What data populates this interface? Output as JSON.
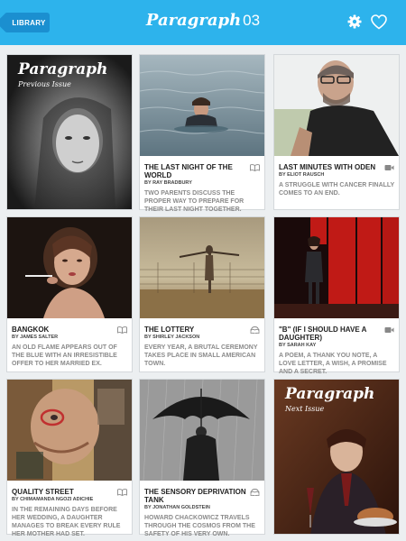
{
  "header": {
    "library_label": "LIBRARY",
    "brand": "Paragraph",
    "issue": "03"
  },
  "previous_cover": {
    "brand": "Paragraph",
    "label": "Previous Issue"
  },
  "next_cover": {
    "brand": "Paragraph",
    "label": "Next Issue"
  },
  "stories": [
    {
      "title": "THE LAST NIGHT OF THE WORLD",
      "author": "BY RAY BRADBURY",
      "description": "Two parents discuss the proper way to prepare for their last night together.",
      "type": "book-icon"
    },
    {
      "title": "LAST MINUTES WITH ODEN",
      "author": "BY ELIOT RAUSCH",
      "description": "A struggle with cancer finally comes to an end.",
      "type": "video-icon"
    },
    {
      "title": "BANGKOK",
      "author": "BY JAMES SALTER",
      "description": "An old flame appears out of the blue with an irresistible offer to her married ex.",
      "type": "book-icon"
    },
    {
      "title": "THE LOTTERY",
      "author": "BY SHIRLEY JACKSON",
      "description": "Every year, a brutal ceremony takes place in small American town.",
      "type": "audiobook-icon"
    },
    {
      "title": "\"B\" (IF I SHOULD HAVE A DAUGHTER)",
      "author": "BY SARAH KAY",
      "description": "A poem, a thank you note, a love letter, a wish, a promise and a secret.",
      "type": "video-icon"
    },
    {
      "title": "QUALITY STREET",
      "author": "BY CHIMAMANDA NGOZI ADICHIE",
      "description": "In the remaining days before her wedding, a daughter manages to break every rule her mother had set.",
      "type": "book-icon"
    },
    {
      "title": "THE SENSORY DEPRIVATION TANK",
      "author": "BY JONATHAN GOLDSTEIN",
      "description": "Howard Chackowicz travels through the cosmos from the safety of his very own.",
      "type": "audiobook-icon"
    }
  ],
  "colors": {
    "header": "#2db3ec",
    "library_button": "#1b8fd0",
    "background": "#eceff1"
  }
}
